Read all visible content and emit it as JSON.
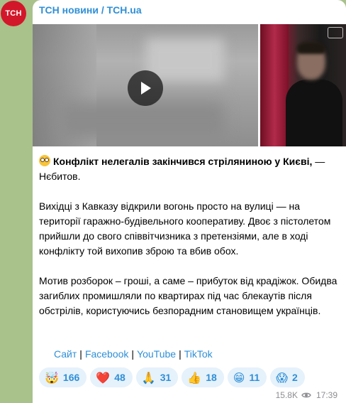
{
  "channel": {
    "name": "ТСН новини / TCH.ua",
    "avatar_text": "ТСН"
  },
  "media": {
    "video_play_icon": "play-icon",
    "thumbnail_blurred": true
  },
  "post": {
    "emoji": "flushed-face",
    "headline_bold": "Конфлікт нелегалів закінчився стріляниною у Києві,",
    "headline_tail": " — Нєбитов.",
    "paragraph_1": "Вихідці з Кавказу відкрили вогонь просто на вулиці — на території гаражно-будівельного кооперативу. Двоє з пістолетом прийшли до свого співвітчизника з претензіями, але в ході конфлікту той вихопив зброю та вбив обох.",
    "paragraph_2": "Мотив розборок – гроші, а саме – прибуток від крадіжок. Обидва загиблих промишляли по квартирах під час блекаутів після обстрілів, користуючись безпорадним становищем українців."
  },
  "links": [
    {
      "label": "Сайт"
    },
    {
      "label": "Facebook"
    },
    {
      "label": "YouTube"
    },
    {
      "label": "TikTok"
    }
  ],
  "link_separator": "|",
  "reactions": [
    {
      "emoji": "🤯",
      "icon": "exploding-head-icon",
      "count": "166"
    },
    {
      "emoji": "❤️",
      "icon": "heart-icon",
      "count": "48"
    },
    {
      "emoji": "🙏",
      "icon": "pray-icon",
      "count": "31"
    },
    {
      "emoji": "👍",
      "icon": "thumbs-up-icon",
      "count": "18"
    },
    {
      "emoji": "😁",
      "icon": "grin-icon",
      "count": "11"
    },
    {
      "emoji": "😱",
      "icon": "scream-icon",
      "count": "2"
    }
  ],
  "meta": {
    "views": "15.8K",
    "time": "17:39"
  },
  "colors": {
    "background": "#a9c18a",
    "accent": "#2f8fd6",
    "avatar": "#d3172a",
    "reaction_bg": "#e5f1fb"
  }
}
